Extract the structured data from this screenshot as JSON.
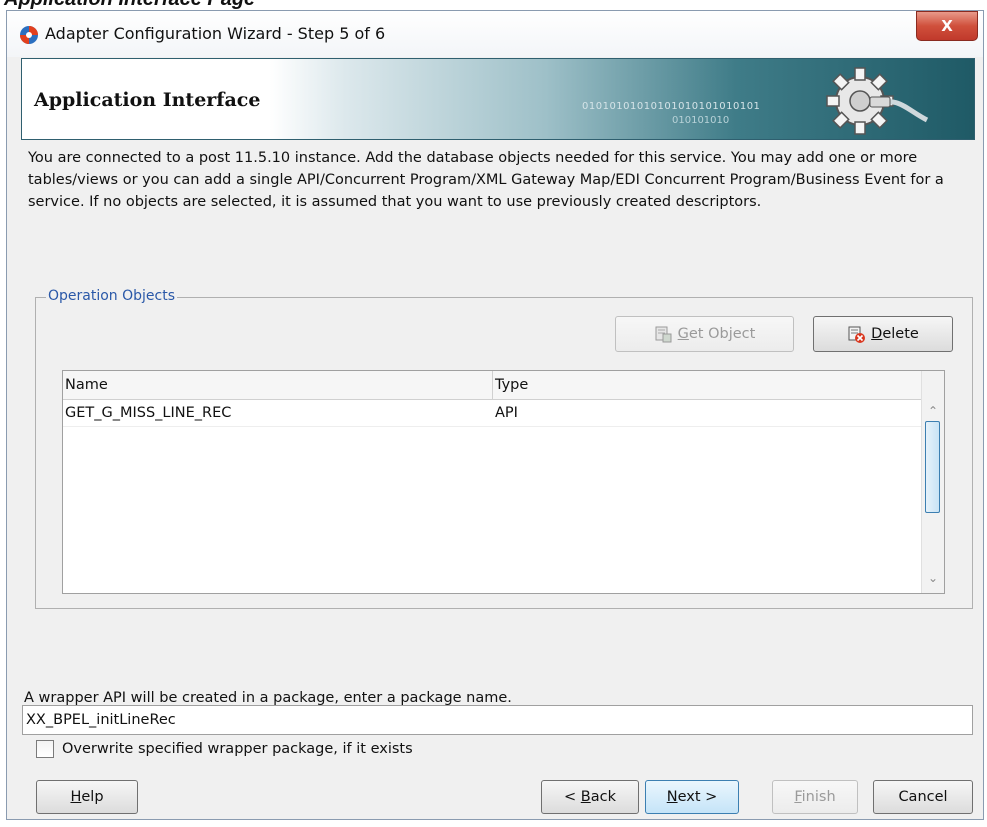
{
  "page_caption": "Application Interface Page",
  "window": {
    "title": "Adapter Configuration Wizard - Step 5 of 6",
    "close_symbol": "X"
  },
  "banner": {
    "title": "Application Interface",
    "binary_text": "01010101010101010101010101",
    "binary_text2": "010101010"
  },
  "description": "You are connected to a post 11.5.10 instance. Add the database objects needed for this service. You may add one or more tables/views or you can add a single API/Concurrent Program/XML Gateway Map/EDI Concurrent Program/Business Event for a service. If no objects are selected, it is assumed that you want to use previously created descriptors.",
  "operation_objects": {
    "label": "Operation Objects",
    "get_object": {
      "mnemonic": "G",
      "rest": "et Object"
    },
    "delete": {
      "mnemonic": "D",
      "rest": "elete"
    },
    "columns": [
      "Name",
      "Type"
    ],
    "rows": [
      {
        "name": "GET_G_MISS_LINE_REC",
        "type": "API"
      }
    ]
  },
  "package": {
    "label": "A wrapper API will be created in a package, enter a package name.",
    "value": "XX_BPEL_initLineRec",
    "overwrite_label": "Overwrite specified wrapper package, if it exists"
  },
  "footer": {
    "help": {
      "mnemonic": "H",
      "rest": "elp"
    },
    "back": {
      "prefix": "< ",
      "mnemonic": "B",
      "rest": "ack"
    },
    "next": {
      "mnemonic": "N",
      "rest": "ext >"
    },
    "finish": {
      "mnemonic": "F",
      "rest": "inish"
    },
    "cancel": "Cancel"
  },
  "icons": [
    "app-logo-icon",
    "close-icon",
    "gear-icon",
    "get-object-icon",
    "delete-icon",
    "scroll-up-icon",
    "scroll-down-icon"
  ]
}
